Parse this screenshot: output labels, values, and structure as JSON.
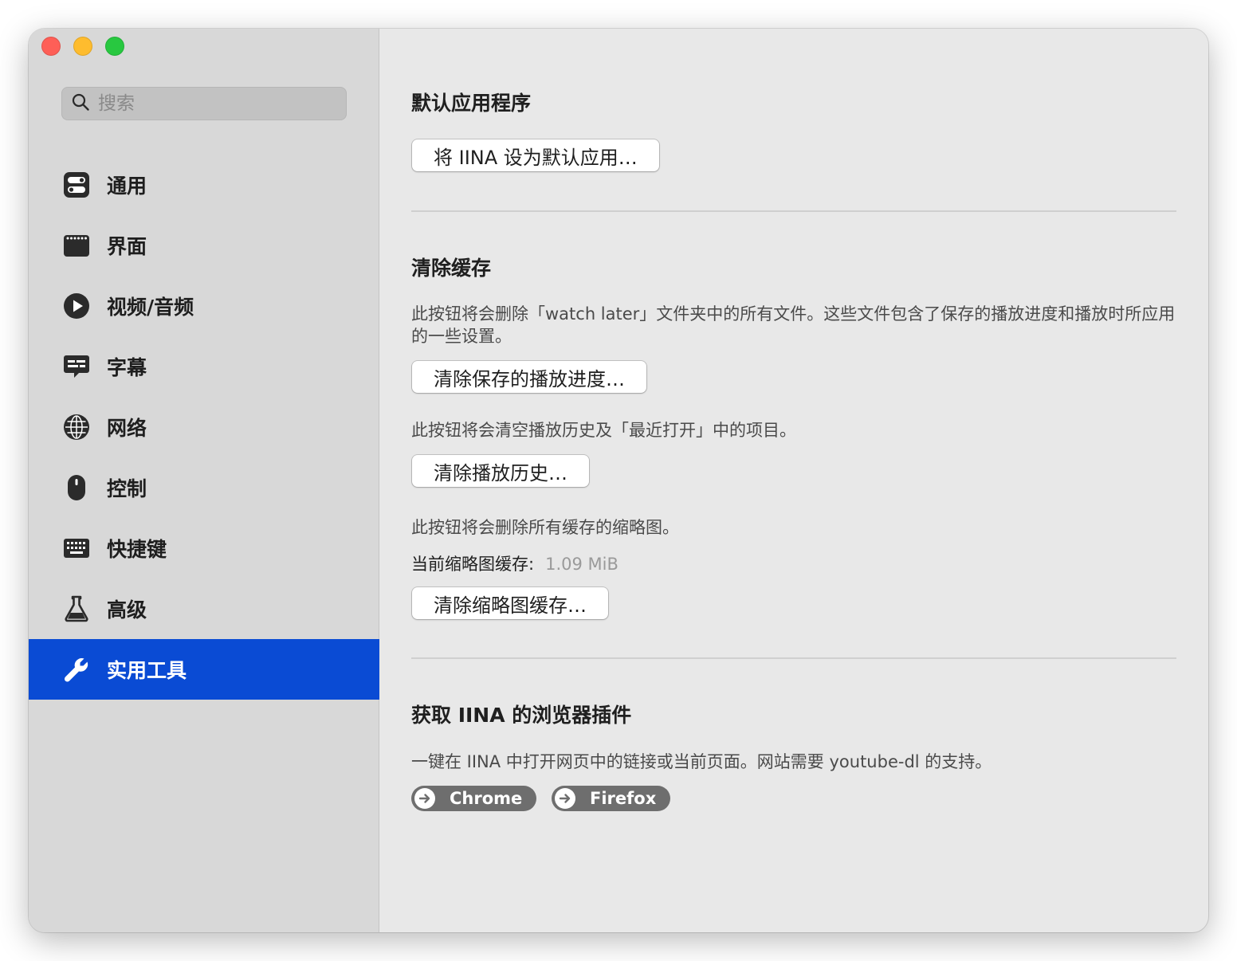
{
  "sidebar": {
    "search": {
      "placeholder": "搜索"
    },
    "items": [
      {
        "label": "通用",
        "icon": "toggles-icon"
      },
      {
        "label": "界面",
        "icon": "window-icon"
      },
      {
        "label": "视频/音频",
        "icon": "play-circle-icon"
      },
      {
        "label": "字幕",
        "icon": "caption-bubble-icon"
      },
      {
        "label": "网络",
        "icon": "globe-icon"
      },
      {
        "label": "控制",
        "icon": "mouse-icon"
      },
      {
        "label": "快捷键",
        "icon": "keyboard-icon"
      },
      {
        "label": "高级",
        "icon": "flask-icon"
      },
      {
        "label": "实用工具",
        "icon": "wrench-icon",
        "active": true
      }
    ],
    "active_color": "#0a4bd4"
  },
  "main": {
    "default_app": {
      "title": "默认应用程序",
      "button": "将 IINA 设为默认应用…"
    },
    "clear_cache": {
      "title": "清除缓存",
      "watch_later_desc": "此按钮将会删除「watch later」文件夹中的所有文件。这些文件包含了保存的播放进度和播放时所应用的一些设置。",
      "watch_later_button": "清除保存的播放进度…",
      "history_desc": "此按钮将会清空播放历史及「最近打开」中的项目。",
      "history_button": "清除播放历史…",
      "thumb_desc": "此按钮将会删除所有缓存的缩略图。",
      "thumb_label": "当前缩略图缓存:",
      "thumb_value": "1.09 MiB",
      "thumb_button": "清除缩略图缓存…"
    },
    "browser_ext": {
      "title": "获取 IINA 的浏览器插件",
      "desc": "一键在 IINA 中打开网页中的链接或当前页面。网站需要 youtube-dl 的支持。",
      "chrome": "Chrome",
      "firefox": "Firefox"
    }
  }
}
